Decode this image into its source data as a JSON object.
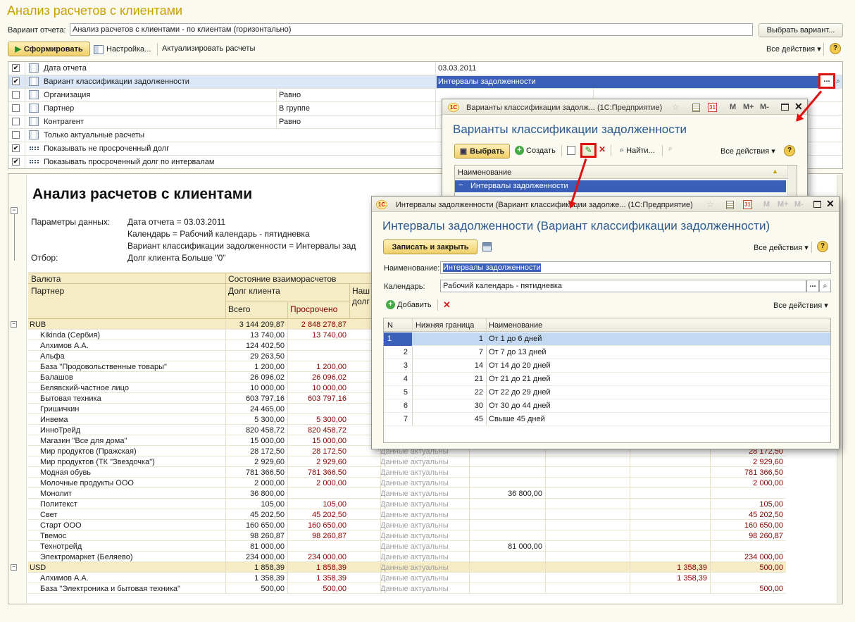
{
  "main": {
    "title": "Анализ расчетов с клиентами",
    "variant_label": "Вариант отчета:",
    "variant_value": "Анализ расчетов с клиентами - по клиентам (горизонтально)",
    "choose_variant": "Выбрать вариант...",
    "generate": "Сформировать",
    "settings": "Настройка...",
    "actualize": "Актуализировать расчеты",
    "all_actions": "Все действия",
    "help": "?"
  },
  "settings_rows": [
    {
      "checked": true,
      "icon": "table-icon",
      "label": "Дата отчета",
      "cond": "",
      "value": "03.03.2011"
    },
    {
      "checked": true,
      "icon": "table-icon",
      "label": "Вариант классификации задолженности",
      "cond": "",
      "value": "Интервалы задолженности"
    },
    {
      "checked": false,
      "icon": "table-icon",
      "label": "Организация",
      "cond": "Равно",
      "value": ""
    },
    {
      "checked": false,
      "icon": "table-icon",
      "label": "Партнер",
      "cond": "В группе",
      "value": ""
    },
    {
      "checked": false,
      "icon": "table-icon",
      "label": "Контрагент",
      "cond": "Равно",
      "value": ""
    },
    {
      "checked": false,
      "icon": "table-icon",
      "label": "Только актуальные расчеты",
      "cond": "",
      "value": ""
    },
    {
      "checked": true,
      "icon": "flag-icon",
      "label": "Показывать не просроченный долг",
      "cond": "",
      "value": ""
    },
    {
      "checked": true,
      "icon": "flag-icon",
      "label": "Показывать просроченный долг по интервалам",
      "cond": "",
      "value": ""
    }
  ],
  "report": {
    "heading": "Анализ расчетов с клиентами",
    "params_label": "Параметры данных:",
    "params": [
      "Дата отчета = 03.03.2011",
      "Календарь = Рабочий календарь - пятидневка",
      "Вариант классификации задолженности = Интервалы зад"
    ],
    "filter_label": "Отбор:",
    "filter_value": "Долг клиента Больше \"0\"",
    "h_currency": "Валюта",
    "h_state": "Состояние взаиморасчетов",
    "h_partner": "Партнер",
    "h_debt": "Долг клиента",
    "h_our": "Наш",
    "h_our2": "долг",
    "h_total": "Всего",
    "h_overdue": "Просрочено",
    "rows": [
      {
        "name": "RUB",
        "group": true,
        "total": "3 144 209,87",
        "overdue": "2 848 278,87",
        "state": "",
        "c1": "",
        "c2": "",
        "c3": "",
        "c4": ""
      },
      {
        "name": "Kikinda (Сербия)",
        "total": "13 740,00",
        "overdue": "13 740,00",
        "state": "",
        "c1": "",
        "c2": "",
        "c3": "",
        "c4": ""
      },
      {
        "name": "Алхимов А.А.",
        "total": "124 402,50",
        "overdue": "",
        "state": "",
        "c1": "",
        "c2": "",
        "c3": "",
        "c4": ""
      },
      {
        "name": "Альфа",
        "total": "29 263,50",
        "overdue": "",
        "state": "",
        "c1": "",
        "c2": "",
        "c3": "",
        "c4": ""
      },
      {
        "name": "База \"Продовольственные товары\"",
        "total": "1 200,00",
        "overdue": "1 200,00",
        "state": "",
        "c1": "",
        "c2": "",
        "c3": "",
        "c4": ""
      },
      {
        "name": "Балашов",
        "total": "26 096,02",
        "overdue": "26 096,02",
        "state": "",
        "c1": "",
        "c2": "",
        "c3": "",
        "c4": ""
      },
      {
        "name": "Белявский-частное лицо",
        "total": "10 000,00",
        "overdue": "10 000,00",
        "state": "",
        "c1": "",
        "c2": "",
        "c3": "",
        "c4": ""
      },
      {
        "name": "Бытовая техника",
        "total": "603 797,16",
        "overdue": "603 797,16",
        "state": "",
        "c1": "",
        "c2": "",
        "c3": "",
        "c4": ""
      },
      {
        "name": "Гришичкин",
        "total": "24 465,00",
        "overdue": "",
        "state": "",
        "c1": "",
        "c2": "",
        "c3": "",
        "c4": ""
      },
      {
        "name": "Инвема",
        "total": "5 300,00",
        "overdue": "5 300,00",
        "state": "",
        "c1": "",
        "c2": "",
        "c3": "",
        "c4": ""
      },
      {
        "name": "ИнноТрейд",
        "total": "820 458,72",
        "overdue": "820 458,72",
        "state": "",
        "c1": "",
        "c2": "",
        "c3": "",
        "c4": ""
      },
      {
        "name": "Магазин \"Все для дома\"",
        "total": "15 000,00",
        "overdue": "15 000,00",
        "state": "",
        "c1": "",
        "c2": "",
        "c3": "",
        "c4": ""
      },
      {
        "name": "Мир продуктов (Пражская)",
        "total": "28 172,50",
        "overdue": "28 172,50",
        "state": "Данные актуальны",
        "c1": "",
        "c2": "",
        "c3": "",
        "c4": "28 172,50"
      },
      {
        "name": "Мир продуктов (ТК \"Звездочка\")",
        "total": "2 929,60",
        "overdue": "2 929,60",
        "state": "Данные актуальны",
        "c1": "",
        "c2": "",
        "c3": "",
        "c4": "2 929,60"
      },
      {
        "name": "Модная обувь",
        "total": "781 366,50",
        "overdue": "781 366,50",
        "state": "Данные актуальны",
        "c1": "",
        "c2": "",
        "c3": "",
        "c4": "781 366,50"
      },
      {
        "name": "Молочные продукты ООО",
        "total": "2 000,00",
        "overdue": "2 000,00",
        "state": "Данные актуальны",
        "c1": "",
        "c2": "",
        "c3": "",
        "c4": "2 000,00"
      },
      {
        "name": "Монолит",
        "total": "36 800,00",
        "overdue": "",
        "state": "Данные актуальны",
        "c1": "36 800,00",
        "c2": "",
        "c3": "",
        "c4": ""
      },
      {
        "name": "Политекст",
        "total": "105,00",
        "overdue": "105,00",
        "state": "Данные актуальны",
        "c1": "",
        "c2": "",
        "c3": "",
        "c4": "105,00"
      },
      {
        "name": "Свет",
        "total": "45 202,50",
        "overdue": "45 202,50",
        "state": "Данные актуальны",
        "c1": "",
        "c2": "",
        "c3": "",
        "c4": "45 202,50"
      },
      {
        "name": "Старт ООО",
        "total": "160 650,00",
        "overdue": "160 650,00",
        "state": "Данные актуальны",
        "c1": "",
        "c2": "",
        "c3": "",
        "c4": "160 650,00"
      },
      {
        "name": "Твемос",
        "total": "98 260,87",
        "overdue": "98 260,87",
        "state": "Данные актуальны",
        "c1": "",
        "c2": "",
        "c3": "",
        "c4": "98 260,87"
      },
      {
        "name": "Технотрейд",
        "total": "81 000,00",
        "overdue": "",
        "state": "Данные актуальны",
        "c1": "81 000,00",
        "c2": "",
        "c3": "",
        "c4": ""
      },
      {
        "name": "Электромаркет (Беляево)",
        "total": "234 000,00",
        "overdue": "234 000,00",
        "state": "Данные актуальны",
        "c1": "",
        "c2": "",
        "c3": "",
        "c4": "234 000,00"
      },
      {
        "name": "USD",
        "group": true,
        "total": "1 858,39",
        "overdue": "1 858,39",
        "state": "Данные актуальны",
        "c1": "",
        "c2": "",
        "c3": "1 358,39",
        "c4": "500,00"
      },
      {
        "name": "Алхимов А.А.",
        "total": "1 358,39",
        "overdue": "1 358,39",
        "state": "Данные актуальны",
        "c1": "",
        "c2": "",
        "c3": "1 358,39",
        "c4": ""
      },
      {
        "name": "База \"Электроника и бытовая техника\"",
        "total": "500,00",
        "overdue": "500,00",
        "state": "Данные актуальны",
        "c1": "",
        "c2": "",
        "c3": "",
        "c4": "500,00"
      }
    ]
  },
  "win_variants": {
    "title": "Варианты классификации задолж...  (1С:Предприятие)",
    "heading": "Варианты классификации задолженности",
    "select": "Выбрать",
    "create": "Создать",
    "find": "Найти...",
    "all_actions": "Все действия",
    "col_name": "Наименование",
    "row1": "Интервалы задолженности",
    "m1": "M",
    "m2": "M+",
    "m3": "M-"
  },
  "win_intervals": {
    "title": "Интервалы задолженности (Вариант классификации задолже...  (1С:Предприятие)",
    "heading": "Интервалы задолженности (Вариант классификации задолженности)",
    "save_close": "Записать и закрыть",
    "all_actions": "Все действия",
    "name_label": "Наименование:",
    "name_value": "Интервалы задолженности",
    "calendar_label": "Календарь:",
    "calendar_value": "Рабочий календарь - пятидневка",
    "add": "Добавить",
    "all_actions2": "Все действия",
    "col_n": "N",
    "col_lower": "Нижняя граница",
    "col_name": "Наименование",
    "rows": [
      {
        "n": "1",
        "lower": "1",
        "name": "От 1 до 6 дней"
      },
      {
        "n": "2",
        "lower": "7",
        "name": "От 7 до 13 дней"
      },
      {
        "n": "3",
        "lower": "14",
        "name": "От 14 до 20 дней"
      },
      {
        "n": "4",
        "lower": "21",
        "name": "От 21 до 21 дней"
      },
      {
        "n": "5",
        "lower": "22",
        "name": "От 22 до 29 дней"
      },
      {
        "n": "6",
        "lower": "30",
        "name": "От 30 до 44 дней"
      },
      {
        "n": "7",
        "lower": "45",
        "name": "Свыше 45 дней"
      }
    ],
    "m1": "M",
    "m2": "M+",
    "m3": "M-"
  }
}
